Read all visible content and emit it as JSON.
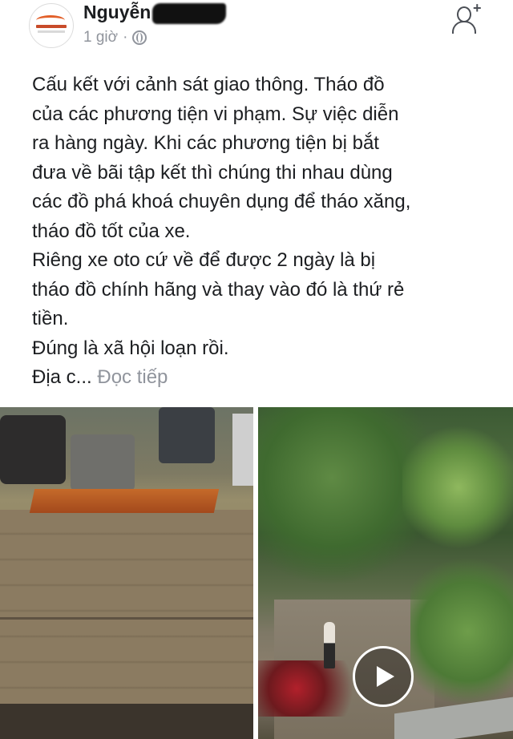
{
  "post": {
    "author": "Nguyễn",
    "timestamp": "1 giờ",
    "separator": "·",
    "privacy_icon": "globe-icon",
    "lines": [
      "Cấu kết với cảnh sát giao thông. Tháo đồ",
      "của các phương tiện vi phạm. Sự việc diễn",
      "ra hàng ngày. Khi các phương tiện bị bắt",
      "đưa về bãi tập kết thì chúng thi nhau dùng",
      "các đồ phá khoá chuyên dụng để tháo xăng,",
      "tháo đồ tốt của xe.",
      "Riêng xe oto cứ về để được 2 ngày là bị",
      "tháo đồ chính hãng và thay vào đó là thứ rẻ",
      "tiền.",
      "Đúng là xã hội loạn rồi."
    ],
    "truncated_line": "Địa c...",
    "see_more": "Đọc tiếp"
  },
  "actions": {
    "add_friend_icon": "add-friend-icon",
    "add_friend_symbol": "+"
  },
  "media": {
    "left_image": "tow-truck-yard-photo",
    "right_image": "motorbike-lot-video",
    "video_icon": "play-icon"
  },
  "colors": {
    "text": "#1c1e21",
    "meta": "#90949c",
    "logo_accent": "#e2602a"
  }
}
